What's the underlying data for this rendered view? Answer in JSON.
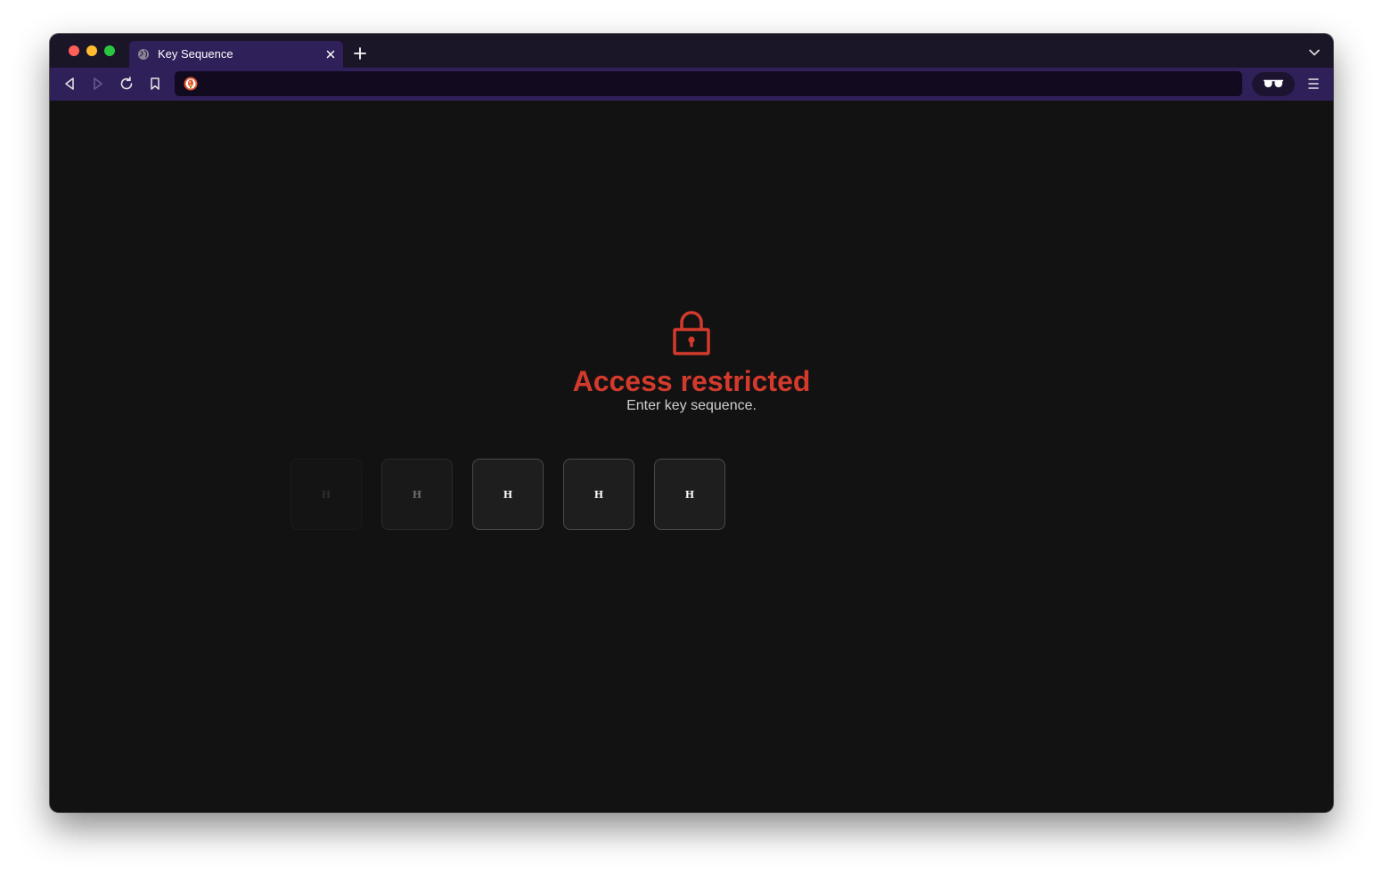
{
  "browser": {
    "tab": {
      "title": "Key Sequence"
    },
    "address_bar": {
      "value": ""
    }
  },
  "page": {
    "heading": "Access restricted",
    "subtext": "Enter key sequence.",
    "accent_color": "#d33a2c",
    "keys": [
      "H",
      "H",
      "H",
      "H",
      "H"
    ]
  },
  "icons": {
    "window_controls": [
      "close-window-icon",
      "minimize-window-icon",
      "zoom-window-icon"
    ],
    "tab": [
      "globe-icon",
      "close-icon"
    ],
    "toolbar": [
      "back-icon",
      "forward-icon",
      "reload-icon",
      "bookmark-icon",
      "duckduckgo-icon",
      "privacy-glasses-icon",
      "menu-icon"
    ],
    "content": [
      "lock-icon"
    ]
  }
}
